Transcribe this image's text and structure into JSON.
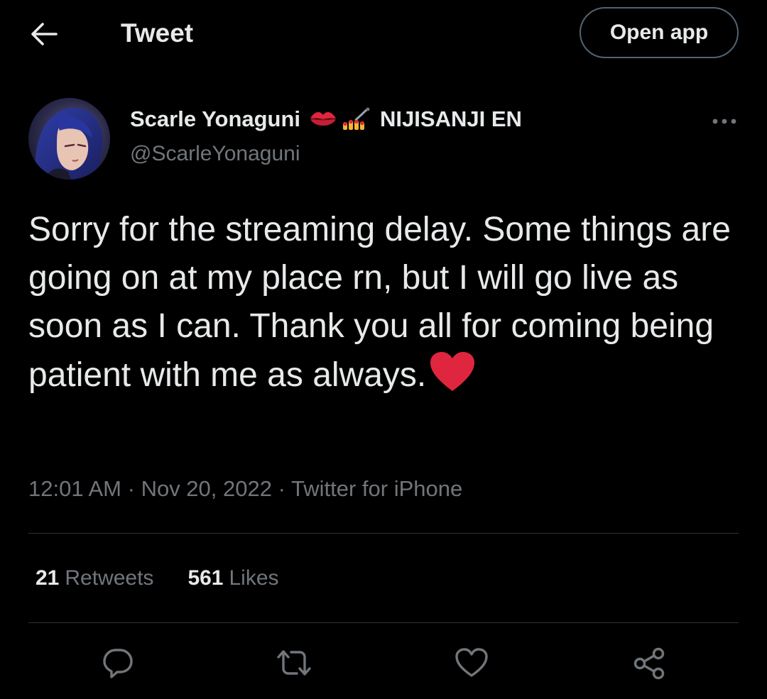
{
  "header": {
    "back_icon": "arrow-left-icon",
    "title": "Tweet",
    "open_app_label": "Open app"
  },
  "author": {
    "name": "Scarle Yonaguni",
    "name_emojis": [
      "kiss-mark-emoji",
      "nail-polish-emoji"
    ],
    "name_suffix": "NIJISANJI EN",
    "handle": "@ScarleYonaguni",
    "more_icon": "more-dots-icon"
  },
  "tweet": {
    "text": "Sorry for the streaming delay. Some things are going on at my place rn, but I will go live as soon as I can. Thank you all for coming being patient with me as always.",
    "trailing_emoji": "red-heart-emoji",
    "time": "12:01 AM",
    "separator": "·",
    "date": "Nov 20, 2022",
    "source": "Twitter for iPhone"
  },
  "stats": {
    "retweets_count": "21",
    "retweets_label": "Retweets",
    "likes_count": "561",
    "likes_label": "Likes"
  },
  "actions": [
    "reply-icon",
    "retweet-icon",
    "like-icon",
    "share-icon"
  ],
  "colors": {
    "background": "#000000",
    "text_primary": "#e7e9ea",
    "text_secondary": "#71767b",
    "divider": "#2f3336",
    "heart": "#e0263f"
  }
}
